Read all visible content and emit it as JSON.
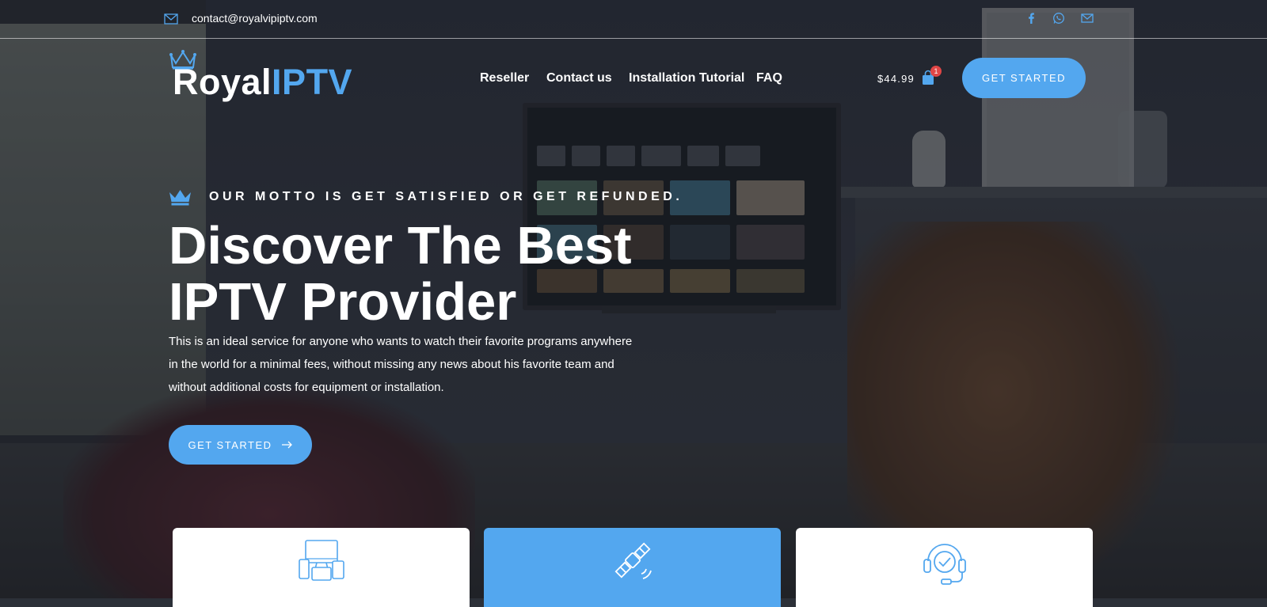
{
  "topbar": {
    "email": "contact@royalvipiptv.com",
    "social_icons": [
      "facebook-icon",
      "whatsapp-icon",
      "mail-icon"
    ]
  },
  "header": {
    "logo_part1": "Royal",
    "logo_part2": "IPTV",
    "nav": [
      {
        "label": "Reseller"
      },
      {
        "label": "Contact us"
      },
      {
        "label": "Installation Tutorial"
      },
      {
        "label": "FAQ"
      }
    ],
    "cart_price": "$44.99",
    "cart_count": "1",
    "cta_label": "GET STARTED"
  },
  "hero": {
    "motto": "OUR MOTTO IS GET SATISFIED OR GET REFUNDED.",
    "title_line1": "Discover The Best",
    "title_line2": "IPTV Provider",
    "description": "This is an ideal service for anyone who wants to watch their favorite programs anywhere in the world for a minimal fees, without missing any news about his favorite team and without additional costs for equipment or installation.",
    "cta_label": "GET STARTED"
  },
  "features": [
    {
      "icon": "devices-icon",
      "style": "white"
    },
    {
      "icon": "satellite-icon",
      "style": "blue"
    },
    {
      "icon": "support-headset-icon",
      "style": "white"
    }
  ],
  "colors": {
    "accent": "#53a7ef",
    "badge": "#e04646"
  }
}
